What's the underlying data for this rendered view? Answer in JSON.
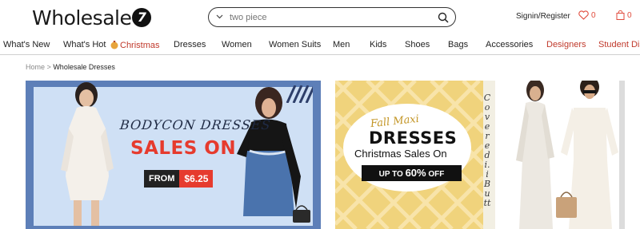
{
  "header": {
    "logo_text": "Wholesale",
    "logo_mark": "7",
    "search_placeholder": "two piece",
    "signin_label": "Signin/Register",
    "wishlist_count": "0",
    "cart_count": "0",
    "accent_color": "#e04a3b"
  },
  "nav": {
    "items": [
      {
        "label": "What's New"
      },
      {
        "label": "What's Hot"
      },
      {
        "label": "Christmas"
      },
      {
        "label": "Dresses"
      },
      {
        "label": "Women"
      },
      {
        "label": "Women Suits"
      },
      {
        "label": "Men"
      },
      {
        "label": "Kids"
      },
      {
        "label": "Shoes"
      },
      {
        "label": "Bags"
      },
      {
        "label": "Accessories"
      },
      {
        "label": "Designers"
      },
      {
        "label": "Student Disco"
      }
    ]
  },
  "breadcrumb": {
    "home": "Home",
    "separator": ">",
    "current": "Wholesale Dresses"
  },
  "banner_left": {
    "title": "BODYCON DRESSES",
    "headline": "SALES ON",
    "from_label": "FROM",
    "price": "$6.25"
  },
  "banner_right": {
    "script": "Fall Maxi",
    "title": "DRESSES",
    "subtitle": "Christmas Sales On",
    "badge_prefix": "UP TO",
    "badge_value": "60%",
    "badge_suffix": "OFF",
    "vertical_text": "Covered i.i Butt"
  }
}
